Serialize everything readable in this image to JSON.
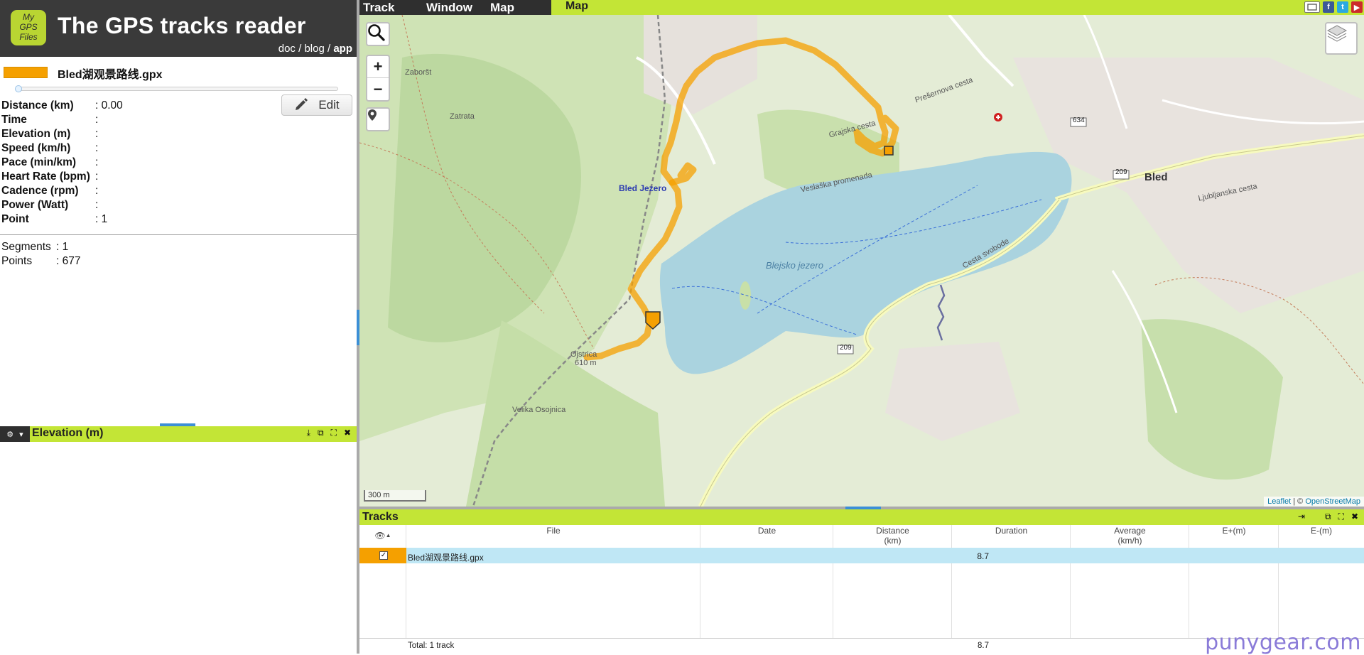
{
  "header": {
    "logo_lines": [
      "My",
      "GPS",
      "Files"
    ],
    "title": "The GPS tracks reader",
    "links": {
      "doc": "doc",
      "sep1": " / ",
      "blog": "blog",
      "sep2": " / ",
      "app": "app"
    }
  },
  "track": {
    "name": "Bled湖观景路线.gpx",
    "color": "#f5a000",
    "edit_label": "Edit",
    "stats": [
      {
        "label": "Distance (km)",
        "value": ": 0.00"
      },
      {
        "label": "Time",
        "value": ":"
      },
      {
        "label": "Elevation (m)",
        "value": ":"
      },
      {
        "label": "Speed (km/h)",
        "value": ":"
      },
      {
        "label": "Pace (min/km)",
        "value": ":"
      },
      {
        "label": "Heart Rate (bpm)",
        "value": ":"
      },
      {
        "label": "Cadence (rpm)",
        "value": ":"
      },
      {
        "label": "Power (Watt)",
        "value": ":"
      },
      {
        "label": "Point",
        "value": ": 1"
      }
    ],
    "summary": [
      {
        "label": "Segments",
        "value": ": 1"
      },
      {
        "label": "Points",
        "value": ": 677"
      }
    ]
  },
  "elevation_panel": {
    "title": "Elevation (m)"
  },
  "menubar": {
    "track": "Track",
    "window": "Window",
    "map": "Map",
    "map_tab": "Map"
  },
  "map": {
    "scale": "300 m",
    "attribution_leaflet": "Leaflet",
    "attribution_sep": " | © ",
    "attribution_osm": "OpenStreetMap",
    "labels": {
      "bled_jezero": "Bled Jezero",
      "bled": "Bled",
      "lake": "Blejsko jezero",
      "zaborst": "Zaboršt",
      "zatrata": "Zatrata",
      "ojstrica": "Ojstrica",
      "ojstrica_ele": "610 m",
      "velika_osojnica": "Velika Osojnica",
      "ljubljanska": "Ljubljanska cesta",
      "cesta_svobode": "Cesta svobode",
      "veslaska": "Veslaška promenada",
      "road_209": "209",
      "road_634": "634",
      "prezihova": "Prešernova cesta",
      "grajska": "Grajska cesta"
    }
  },
  "tracks_panel": {
    "title": "Tracks",
    "columns": {
      "file": "File",
      "date": "Date",
      "distance": "Distance",
      "distance_unit": "(km)",
      "duration": "Duration",
      "average": "Average",
      "average_unit": "(km/h)",
      "e_plus": "E+(m)",
      "e_minus": "E-(m)"
    },
    "rows": [
      {
        "file": "Bled湖观景路线.gpx",
        "date": "",
        "distance": "8.7",
        "checked": true
      }
    ],
    "total_label": "Total: 1 track",
    "total_distance": "8.7"
  },
  "watermark": "punygear.com"
}
